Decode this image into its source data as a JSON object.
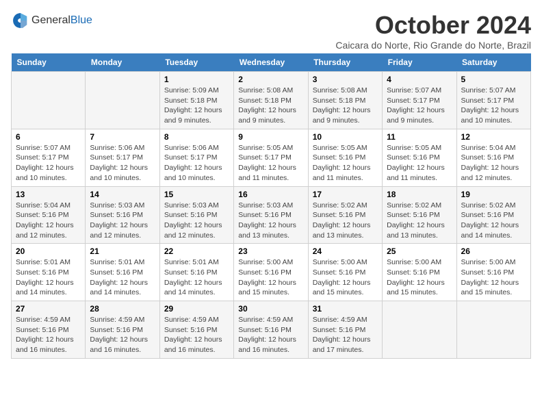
{
  "logo": {
    "general": "General",
    "blue": "Blue"
  },
  "header": {
    "title": "October 2024",
    "location": "Caicara do Norte, Rio Grande do Norte, Brazil"
  },
  "weekdays": [
    "Sunday",
    "Monday",
    "Tuesday",
    "Wednesday",
    "Thursday",
    "Friday",
    "Saturday"
  ],
  "weeks": [
    [
      {
        "day": "",
        "info": ""
      },
      {
        "day": "",
        "info": ""
      },
      {
        "day": "1",
        "info": "Sunrise: 5:09 AM\nSunset: 5:18 PM\nDaylight: 12 hours and 9 minutes."
      },
      {
        "day": "2",
        "info": "Sunrise: 5:08 AM\nSunset: 5:18 PM\nDaylight: 12 hours and 9 minutes."
      },
      {
        "day": "3",
        "info": "Sunrise: 5:08 AM\nSunset: 5:18 PM\nDaylight: 12 hours and 9 minutes."
      },
      {
        "day": "4",
        "info": "Sunrise: 5:07 AM\nSunset: 5:17 PM\nDaylight: 12 hours and 9 minutes."
      },
      {
        "day": "5",
        "info": "Sunrise: 5:07 AM\nSunset: 5:17 PM\nDaylight: 12 hours and 10 minutes."
      }
    ],
    [
      {
        "day": "6",
        "info": "Sunrise: 5:07 AM\nSunset: 5:17 PM\nDaylight: 12 hours and 10 minutes."
      },
      {
        "day": "7",
        "info": "Sunrise: 5:06 AM\nSunset: 5:17 PM\nDaylight: 12 hours and 10 minutes."
      },
      {
        "day": "8",
        "info": "Sunrise: 5:06 AM\nSunset: 5:17 PM\nDaylight: 12 hours and 10 minutes."
      },
      {
        "day": "9",
        "info": "Sunrise: 5:05 AM\nSunset: 5:17 PM\nDaylight: 12 hours and 11 minutes."
      },
      {
        "day": "10",
        "info": "Sunrise: 5:05 AM\nSunset: 5:16 PM\nDaylight: 12 hours and 11 minutes."
      },
      {
        "day": "11",
        "info": "Sunrise: 5:05 AM\nSunset: 5:16 PM\nDaylight: 12 hours and 11 minutes."
      },
      {
        "day": "12",
        "info": "Sunrise: 5:04 AM\nSunset: 5:16 PM\nDaylight: 12 hours and 12 minutes."
      }
    ],
    [
      {
        "day": "13",
        "info": "Sunrise: 5:04 AM\nSunset: 5:16 PM\nDaylight: 12 hours and 12 minutes."
      },
      {
        "day": "14",
        "info": "Sunrise: 5:03 AM\nSunset: 5:16 PM\nDaylight: 12 hours and 12 minutes."
      },
      {
        "day": "15",
        "info": "Sunrise: 5:03 AM\nSunset: 5:16 PM\nDaylight: 12 hours and 12 minutes."
      },
      {
        "day": "16",
        "info": "Sunrise: 5:03 AM\nSunset: 5:16 PM\nDaylight: 12 hours and 13 minutes."
      },
      {
        "day": "17",
        "info": "Sunrise: 5:02 AM\nSunset: 5:16 PM\nDaylight: 12 hours and 13 minutes."
      },
      {
        "day": "18",
        "info": "Sunrise: 5:02 AM\nSunset: 5:16 PM\nDaylight: 12 hours and 13 minutes."
      },
      {
        "day": "19",
        "info": "Sunrise: 5:02 AM\nSunset: 5:16 PM\nDaylight: 12 hours and 14 minutes."
      }
    ],
    [
      {
        "day": "20",
        "info": "Sunrise: 5:01 AM\nSunset: 5:16 PM\nDaylight: 12 hours and 14 minutes."
      },
      {
        "day": "21",
        "info": "Sunrise: 5:01 AM\nSunset: 5:16 PM\nDaylight: 12 hours and 14 minutes."
      },
      {
        "day": "22",
        "info": "Sunrise: 5:01 AM\nSunset: 5:16 PM\nDaylight: 12 hours and 14 minutes."
      },
      {
        "day": "23",
        "info": "Sunrise: 5:00 AM\nSunset: 5:16 PM\nDaylight: 12 hours and 15 minutes."
      },
      {
        "day": "24",
        "info": "Sunrise: 5:00 AM\nSunset: 5:16 PM\nDaylight: 12 hours and 15 minutes."
      },
      {
        "day": "25",
        "info": "Sunrise: 5:00 AM\nSunset: 5:16 PM\nDaylight: 12 hours and 15 minutes."
      },
      {
        "day": "26",
        "info": "Sunrise: 5:00 AM\nSunset: 5:16 PM\nDaylight: 12 hours and 15 minutes."
      }
    ],
    [
      {
        "day": "27",
        "info": "Sunrise: 4:59 AM\nSunset: 5:16 PM\nDaylight: 12 hours and 16 minutes."
      },
      {
        "day": "28",
        "info": "Sunrise: 4:59 AM\nSunset: 5:16 PM\nDaylight: 12 hours and 16 minutes."
      },
      {
        "day": "29",
        "info": "Sunrise: 4:59 AM\nSunset: 5:16 PM\nDaylight: 12 hours and 16 minutes."
      },
      {
        "day": "30",
        "info": "Sunrise: 4:59 AM\nSunset: 5:16 PM\nDaylight: 12 hours and 16 minutes."
      },
      {
        "day": "31",
        "info": "Sunrise: 4:59 AM\nSunset: 5:16 PM\nDaylight: 12 hours and 17 minutes."
      },
      {
        "day": "",
        "info": ""
      },
      {
        "day": "",
        "info": ""
      }
    ]
  ]
}
